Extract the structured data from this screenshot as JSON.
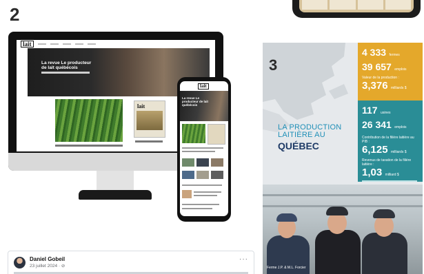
{
  "labels": {
    "two": "2",
    "three": "3"
  },
  "desktop": {
    "logo": "lait",
    "hero_title": "La revue Le producteur de lait québécois",
    "magazine_logo": "lait"
  },
  "phone": {
    "logo": "lait",
    "hero_title": "La revue Le producteur de lait québécois",
    "magazine_logo": "lait"
  },
  "flyer": {
    "title": "LA PRODUCTION LAITIÈRE AU",
    "region": "QUÉBEC",
    "stats_gold": [
      {
        "value": "4 333",
        "unit": "fermes"
      },
      {
        "value": "39 657",
        "unit": "emplois"
      }
    ],
    "production_label": "Valeur de la production :",
    "production_value": "3,376",
    "production_unit": "milliards $",
    "stats_teal": [
      {
        "value": "117",
        "unit": "usines"
      },
      {
        "value": "26 341",
        "unit": "emplois"
      }
    ],
    "pib_label": "Contribution de la filière laitière au PIB :",
    "pib_value": "6,125",
    "pib_unit": "milliards $",
    "tax_label": "Revenus de taxation de la filière laitière :",
    "tax_value": "1,03",
    "tax_unit": "milliard $",
    "photo_caption": "Ferme J.P. & M.L. Forcier"
  },
  "post": {
    "author": "Daniel Gobeil",
    "date": "23 juillet 2024 · ⊘",
    "more": "···"
  },
  "colors": {
    "gold": "#e4a82b",
    "teal": "#2a8d96",
    "title_blue": "#1f8fb7",
    "quebec_navy": "#1e3a66"
  }
}
